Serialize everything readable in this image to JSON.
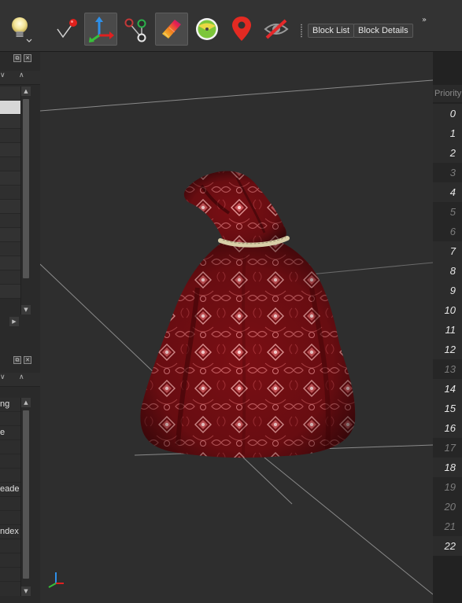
{
  "toolbar": {
    "tools": [
      {
        "name": "lighting-bulb-icon",
        "active": false
      },
      {
        "name": "pin-pointer-icon",
        "active": false
      },
      {
        "name": "move-axes-icon",
        "active": true
      },
      {
        "name": "node-graph-icon",
        "active": false
      },
      {
        "name": "gradient-texture-icon",
        "active": true
      },
      {
        "name": "green-sphere-icon",
        "active": false
      },
      {
        "name": "location-marker-icon",
        "active": false
      },
      {
        "name": "hidden-eye-icon",
        "active": false
      }
    ],
    "block_list_label": "Block List",
    "block_details_label": "Block Details",
    "overflow_label": "»"
  },
  "top_panel": {
    "restore_label": "⧉",
    "close_label": "✕",
    "rows": 15,
    "selected_index": 1
  },
  "bottom_panel": {
    "restore_label": "⧉",
    "close_label": "✕",
    "property_labels": [
      "ng",
      "",
      "e",
      "",
      "",
      "",
      "eade",
      "",
      "",
      "ndex",
      "",
      "",
      ""
    ]
  },
  "priority": {
    "header": "Priority",
    "values": [
      "0",
      "1",
      "2",
      "3",
      "4",
      "5",
      "6",
      "7",
      "8",
      "9",
      "10",
      "11",
      "12",
      "13",
      "14",
      "15",
      "16",
      "17",
      "18",
      "19",
      "20",
      "21",
      "22"
    ],
    "dimmed": [
      3,
      5,
      6,
      13,
      17,
      19,
      20,
      21
    ]
  },
  "viewport": {
    "object": "red-patterned-sack",
    "colors": {
      "sack_dark": "#6e0c10",
      "sack_mid": "#9e1a20",
      "pattern": "#e89a9a",
      "tie": "#d9cfa8",
      "background": "#2e2e2e",
      "grid_line": "#8a8a8a"
    }
  }
}
